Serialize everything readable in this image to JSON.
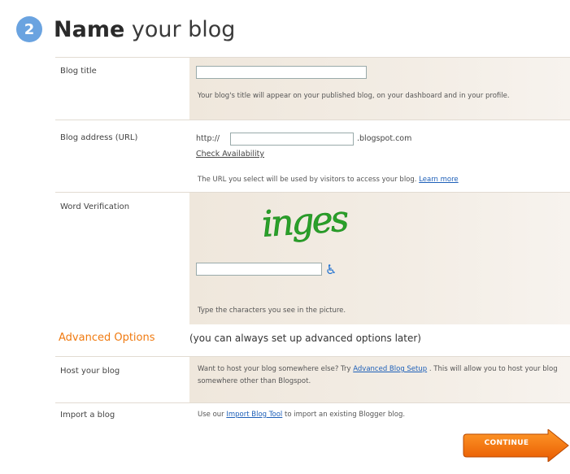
{
  "header": {
    "step_number": "2",
    "title_bold": "Name",
    "title_rest": " your blog"
  },
  "blog_title": {
    "label": "Blog title",
    "value": "",
    "help": "Your blog's title will appear on your published blog, on your dashboard and in your profile."
  },
  "blog_address": {
    "label": "Blog address (URL)",
    "prefix": "http://",
    "value": "",
    "suffix": ".blogspot.com",
    "check_link": "Check Availability",
    "help_text": "The URL you select will be used by visitors to access your blog.",
    "learn_more": "Learn more"
  },
  "word_verification": {
    "label": "Word Verification",
    "captcha_text": "inges",
    "value": "",
    "accessibility_icon": "wheelchair-icon",
    "help": "Type the characters you see in the picture."
  },
  "advanced": {
    "title": "Advanced Options",
    "note": "(you can always set up advanced options later)",
    "host": {
      "label": "Host your blog",
      "text_before": "Want to host your blog somewhere else? Try",
      "link": "Advanced Blog Setup",
      "text_after": ". This will allow you to host your blog somewhere other than Blogspot."
    },
    "import": {
      "label": "Import a blog",
      "text_before": "Use our",
      "link": "Import Blog Tool",
      "text_after": "to import an existing Blogger blog."
    }
  },
  "continue_button": {
    "label": "CONTINUE"
  },
  "colors": {
    "accent_orange": "#f07a10",
    "link_blue": "#1d5fb8",
    "badge_blue": "#6aa3e0",
    "captcha_green": "#2aa02a"
  }
}
